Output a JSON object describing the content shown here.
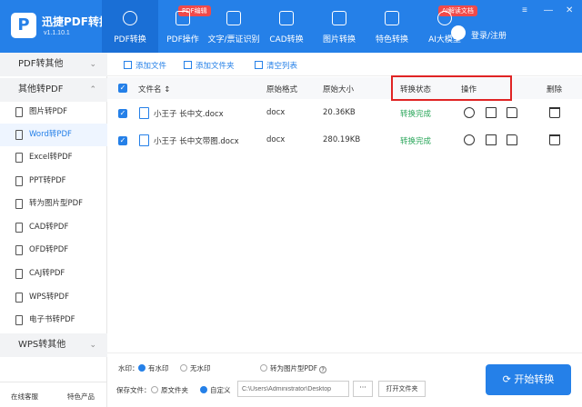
{
  "app": {
    "logo": "P",
    "name": "迅捷PDF转换器",
    "version": "v1.1.10.1"
  },
  "nav": [
    {
      "label": "PDF转换",
      "icon": "convert-icon",
      "active": true
    },
    {
      "label": "PDF操作",
      "icon": "pdf-edit-icon",
      "badge": "PDF编辑"
    },
    {
      "label": "文字/票证识别",
      "icon": "ocr-icon"
    },
    {
      "label": "CAD转换",
      "icon": "cad-icon"
    },
    {
      "label": "图片转换",
      "icon": "image-icon"
    },
    {
      "label": "特色转换",
      "icon": "special-icon"
    },
    {
      "label": "AI大模型",
      "icon": "ai-icon",
      "badge": "AI解读文档"
    }
  ],
  "user": {
    "label": "登录/注册"
  },
  "window_controls": {
    "menu": "≡",
    "minimize": "—",
    "close": "✕"
  },
  "sidebar": {
    "cat_pdf_to_other": "PDF转其他",
    "cat_other_to_pdf": "其他转PDF",
    "items": [
      "图片转PDF",
      "Word转PDF",
      "Excel转PDF",
      "PPT转PDF",
      "转为图片型PDF",
      "CAD转PDF",
      "OFD转PDF",
      "CAJ转PDF",
      "WPS转PDF",
      "电子书转PDF"
    ],
    "active_index": 1,
    "cat_wps_to_other": "WPS转其他",
    "footer": {
      "support": "在线客服",
      "products": "特色产品"
    }
  },
  "toolbar": {
    "add_file": "添加文件",
    "add_folder": "添加文件夹",
    "clear_list": "清空列表"
  },
  "table": {
    "headers": {
      "filename": "文件名 ↕",
      "format": "原始格式",
      "size": "原始大小",
      "status": "转换状态",
      "actions": "操作",
      "delete": "删除"
    },
    "rows": [
      {
        "name": "小王子 长中文.docx",
        "format": "docx",
        "size": "20.36KB",
        "status": "转换完成"
      },
      {
        "name": "小王子 长中文带图.docx",
        "format": "docx",
        "size": "280.19KB",
        "status": "转换完成"
      }
    ]
  },
  "watermark": {
    "label": "水印：",
    "with": "有水印",
    "without": "无水印",
    "image_pdf": "转为图片型PDF",
    "help": "?",
    "selected": "with"
  },
  "save": {
    "label": "保存文件：",
    "original": "原文件夹",
    "custom": "自定义",
    "path": "C:\\Users\\Administrator\\Desktop",
    "browse": "···",
    "open_folder": "打开文件夹",
    "selected": "custom"
  },
  "start_button": "开始转换",
  "colors": {
    "brand": "#2580e8",
    "success": "#2aa65a",
    "annotation": "#e02424"
  }
}
